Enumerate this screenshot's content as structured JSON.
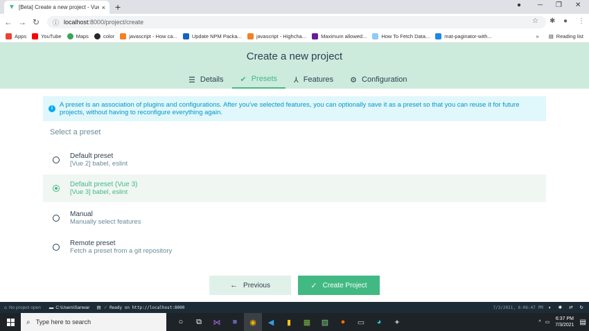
{
  "browser": {
    "tab_title": "[Beta] Create a new project - Vue",
    "tab_close": "×",
    "new_tab": "+",
    "url_host": "localhost",
    "url_rest": ":8000/project/create",
    "bookmarks": [
      {
        "label": "Apps",
        "color": "#ea4335"
      },
      {
        "label": "YouTube",
        "color": "#ff0000"
      },
      {
        "label": "Maps",
        "color": "#34a853"
      },
      {
        "label": "color",
        "color": "#24292e"
      },
      {
        "label": "javascript - How ca...",
        "color": "#f48024"
      },
      {
        "label": "Update NPM Packa...",
        "color": "#1565c0"
      },
      {
        "label": "javascript - Highcha...",
        "color": "#f48024"
      },
      {
        "label": "Maximum allowed...",
        "color": "#6a1b9a"
      },
      {
        "label": "How To Fetch Data...",
        "color": "#90caf9"
      },
      {
        "label": "mat-paginator-with...",
        "color": "#1e88e5"
      }
    ],
    "reading_list": "Reading list",
    "more_bookmarks": "»"
  },
  "app": {
    "title": "Create a new project",
    "steps": [
      {
        "label": "Details",
        "icon": "list-icon"
      },
      {
        "label": "Presets",
        "icon": "check-circle-icon"
      },
      {
        "label": "Features",
        "icon": "tree-icon"
      },
      {
        "label": "Configuration",
        "icon": "gear-box-icon"
      }
    ],
    "info": "A preset is an association of plugins and configurations. After you've selected features, you can optionally save it as a preset so that you can reuse it for future projects, without having to reconfigure everything again.",
    "section_title": "Select a preset",
    "presets": [
      {
        "name": "Default preset",
        "desc": "[Vue 2] babel, eslint"
      },
      {
        "name": "Default preset (Vue 3)",
        "desc": "[Vue 3] babel, eslint"
      },
      {
        "name": "Manual",
        "desc": "Manually select features"
      },
      {
        "name": "Remote preset",
        "desc": "Fetch a preset from a git repository"
      }
    ],
    "selected_preset": 1,
    "prev_label": "Previous",
    "create_label": "Create Project"
  },
  "statusbar": {
    "project": "No project open",
    "path": "C:\\Users\\Sanwar",
    "ready": "Ready on http://localhost:8000",
    "timestamp": "7/3/2021, 6:06:47 PM"
  },
  "taskbar": {
    "search_placeholder": "Type here to search",
    "time": "6:37 PM",
    "date": "7/3/2021"
  }
}
